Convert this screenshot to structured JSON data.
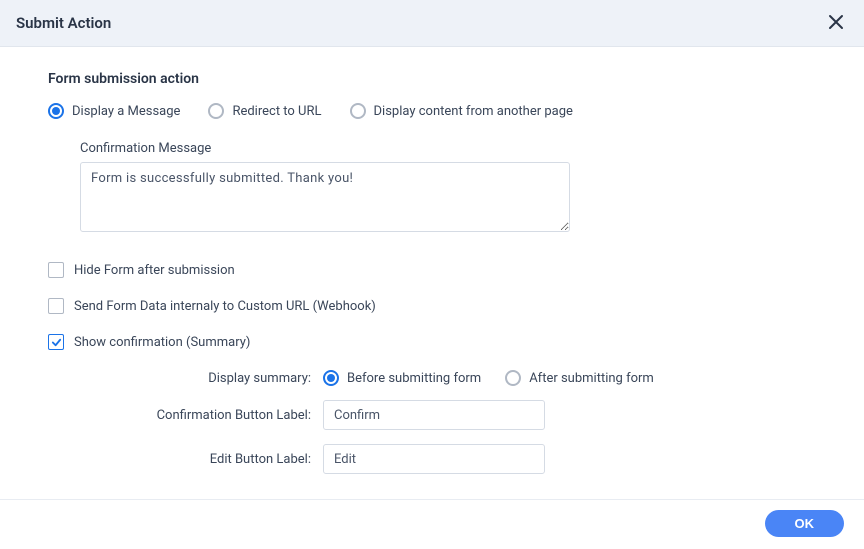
{
  "header": {
    "title": "Submit Action"
  },
  "section": {
    "title": "Form submission action"
  },
  "actionRadios": {
    "display_message": "Display a Message",
    "redirect_url": "Redirect to URL",
    "display_page": "Display content from another page"
  },
  "confirmationMessage": {
    "label": "Confirmation Message",
    "value": "Form is successfully submitted. Thank you!"
  },
  "checkboxes": {
    "hide_form": "Hide Form after submission",
    "webhook": "Send Form Data internaly to Custom URL (Webhook)",
    "show_summary": "Show confirmation (Summary)"
  },
  "summary": {
    "display_label": "Display summary:",
    "before": "Before submitting form",
    "after": "After submitting form",
    "confirm_btn_label": "Confirmation Button Label:",
    "confirm_btn_value": "Confirm",
    "edit_btn_label": "Edit Button Label:",
    "edit_btn_value": "Edit"
  },
  "footer": {
    "ok": "OK"
  }
}
